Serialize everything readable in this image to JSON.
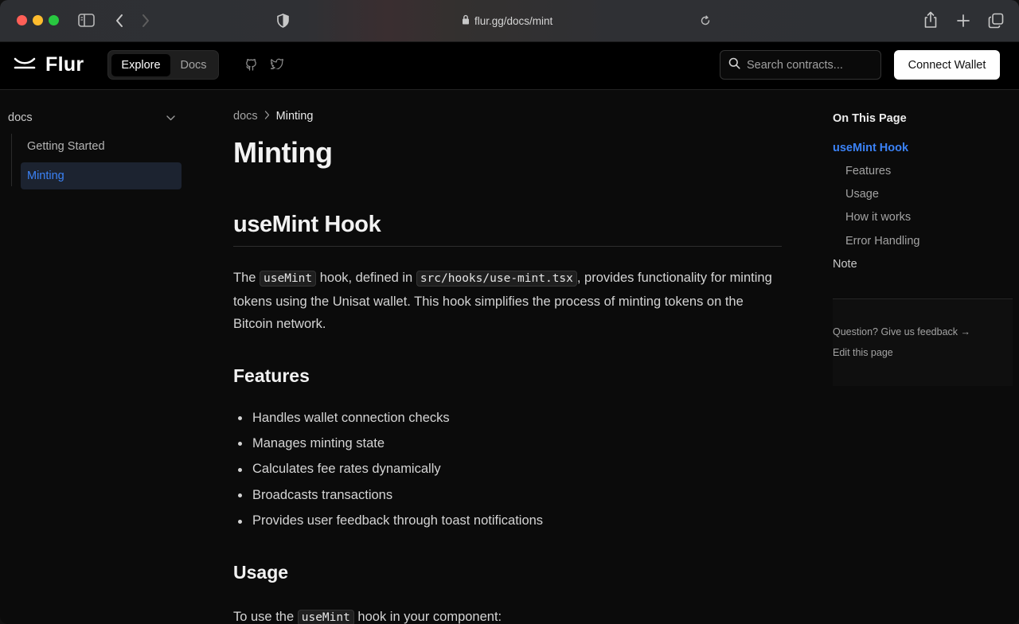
{
  "browser": {
    "url": "flur.gg/docs/mint",
    "icons": [
      "sidebar-toggle-icon",
      "back-icon",
      "forward-icon",
      "shield-icon",
      "lock-icon",
      "reload-icon",
      "share-icon",
      "new-tab-icon",
      "tabs-overview-icon"
    ]
  },
  "header": {
    "brand": "Flur",
    "tabs": [
      {
        "label": "Explore",
        "active": true
      },
      {
        "label": "Docs",
        "active": false
      }
    ],
    "social_icons": [
      "github-icon",
      "twitter-icon"
    ],
    "search_placeholder": "Search contracts...",
    "connect_label": "Connect Wallet"
  },
  "sidebar": {
    "section": "docs",
    "items": [
      {
        "label": "Getting Started",
        "active": false
      },
      {
        "label": "Minting",
        "active": true
      }
    ]
  },
  "breadcrumb": {
    "root": "docs",
    "separator": ">",
    "current": "Minting"
  },
  "content": {
    "title": "Minting",
    "section_heading": "useMint Hook",
    "intro": {
      "p1": "The ",
      "code1": "useMint",
      "p2": " hook, defined in ",
      "code2": "src/hooks/use-mint.tsx",
      "p3": ", provides functionality for minting tokens using the Unisat wallet. This hook simplifies the process of minting tokens on the Bitcoin network."
    },
    "features_heading": "Features",
    "features": [
      "Handles wallet connection checks",
      "Manages minting state",
      "Calculates fee rates dynamically",
      "Broadcasts transactions",
      "Provides user feedback through toast notifications"
    ],
    "usage_heading": "Usage",
    "usage": {
      "p1": "To use the ",
      "code": "useMint",
      "p2": " hook in your component:"
    }
  },
  "toc": {
    "title": "On This Page",
    "items": [
      {
        "label": "useMint Hook",
        "level": 1,
        "active": true
      },
      {
        "label": "Features",
        "level": 2,
        "active": false
      },
      {
        "label": "Usage",
        "level": 2,
        "active": false
      },
      {
        "label": "How it works",
        "level": 2,
        "active": false
      },
      {
        "label": "Error Handling",
        "level": 2,
        "active": false
      },
      {
        "label": "Note",
        "level": 1,
        "active": false
      }
    ],
    "feedback": "Question? Give us feedback →",
    "edit": "Edit this page"
  },
  "colors": {
    "accent": "#3b82f6",
    "background": "#0b0b0b",
    "header": "#000000"
  }
}
